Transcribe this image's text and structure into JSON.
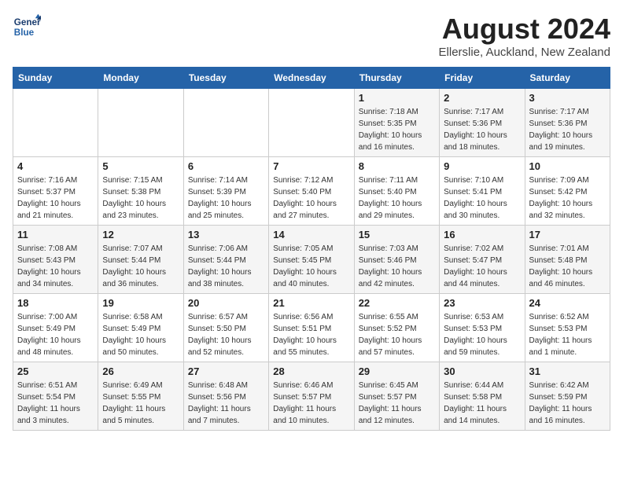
{
  "logo": {
    "line1": "General",
    "line2": "Blue"
  },
  "title": "August 2024",
  "subtitle": "Ellerslie, Auckland, New Zealand",
  "weekdays": [
    "Sunday",
    "Monday",
    "Tuesday",
    "Wednesday",
    "Thursday",
    "Friday",
    "Saturday"
  ],
  "weeks": [
    [
      {
        "day": "",
        "info": ""
      },
      {
        "day": "",
        "info": ""
      },
      {
        "day": "",
        "info": ""
      },
      {
        "day": "",
        "info": ""
      },
      {
        "day": "1",
        "info": "Sunrise: 7:18 AM\nSunset: 5:35 PM\nDaylight: 10 hours\nand 16 minutes."
      },
      {
        "day": "2",
        "info": "Sunrise: 7:17 AM\nSunset: 5:36 PM\nDaylight: 10 hours\nand 18 minutes."
      },
      {
        "day": "3",
        "info": "Sunrise: 7:17 AM\nSunset: 5:36 PM\nDaylight: 10 hours\nand 19 minutes."
      }
    ],
    [
      {
        "day": "4",
        "info": "Sunrise: 7:16 AM\nSunset: 5:37 PM\nDaylight: 10 hours\nand 21 minutes."
      },
      {
        "day": "5",
        "info": "Sunrise: 7:15 AM\nSunset: 5:38 PM\nDaylight: 10 hours\nand 23 minutes."
      },
      {
        "day": "6",
        "info": "Sunrise: 7:14 AM\nSunset: 5:39 PM\nDaylight: 10 hours\nand 25 minutes."
      },
      {
        "day": "7",
        "info": "Sunrise: 7:12 AM\nSunset: 5:40 PM\nDaylight: 10 hours\nand 27 minutes."
      },
      {
        "day": "8",
        "info": "Sunrise: 7:11 AM\nSunset: 5:40 PM\nDaylight: 10 hours\nand 29 minutes."
      },
      {
        "day": "9",
        "info": "Sunrise: 7:10 AM\nSunset: 5:41 PM\nDaylight: 10 hours\nand 30 minutes."
      },
      {
        "day": "10",
        "info": "Sunrise: 7:09 AM\nSunset: 5:42 PM\nDaylight: 10 hours\nand 32 minutes."
      }
    ],
    [
      {
        "day": "11",
        "info": "Sunrise: 7:08 AM\nSunset: 5:43 PM\nDaylight: 10 hours\nand 34 minutes."
      },
      {
        "day": "12",
        "info": "Sunrise: 7:07 AM\nSunset: 5:44 PM\nDaylight: 10 hours\nand 36 minutes."
      },
      {
        "day": "13",
        "info": "Sunrise: 7:06 AM\nSunset: 5:44 PM\nDaylight: 10 hours\nand 38 minutes."
      },
      {
        "day": "14",
        "info": "Sunrise: 7:05 AM\nSunset: 5:45 PM\nDaylight: 10 hours\nand 40 minutes."
      },
      {
        "day": "15",
        "info": "Sunrise: 7:03 AM\nSunset: 5:46 PM\nDaylight: 10 hours\nand 42 minutes."
      },
      {
        "day": "16",
        "info": "Sunrise: 7:02 AM\nSunset: 5:47 PM\nDaylight: 10 hours\nand 44 minutes."
      },
      {
        "day": "17",
        "info": "Sunrise: 7:01 AM\nSunset: 5:48 PM\nDaylight: 10 hours\nand 46 minutes."
      }
    ],
    [
      {
        "day": "18",
        "info": "Sunrise: 7:00 AM\nSunset: 5:49 PM\nDaylight: 10 hours\nand 48 minutes."
      },
      {
        "day": "19",
        "info": "Sunrise: 6:58 AM\nSunset: 5:49 PM\nDaylight: 10 hours\nand 50 minutes."
      },
      {
        "day": "20",
        "info": "Sunrise: 6:57 AM\nSunset: 5:50 PM\nDaylight: 10 hours\nand 52 minutes."
      },
      {
        "day": "21",
        "info": "Sunrise: 6:56 AM\nSunset: 5:51 PM\nDaylight: 10 hours\nand 55 minutes."
      },
      {
        "day": "22",
        "info": "Sunrise: 6:55 AM\nSunset: 5:52 PM\nDaylight: 10 hours\nand 57 minutes."
      },
      {
        "day": "23",
        "info": "Sunrise: 6:53 AM\nSunset: 5:53 PM\nDaylight: 10 hours\nand 59 minutes."
      },
      {
        "day": "24",
        "info": "Sunrise: 6:52 AM\nSunset: 5:53 PM\nDaylight: 11 hours\nand 1 minute."
      }
    ],
    [
      {
        "day": "25",
        "info": "Sunrise: 6:51 AM\nSunset: 5:54 PM\nDaylight: 11 hours\nand 3 minutes."
      },
      {
        "day": "26",
        "info": "Sunrise: 6:49 AM\nSunset: 5:55 PM\nDaylight: 11 hours\nand 5 minutes."
      },
      {
        "day": "27",
        "info": "Sunrise: 6:48 AM\nSunset: 5:56 PM\nDaylight: 11 hours\nand 7 minutes."
      },
      {
        "day": "28",
        "info": "Sunrise: 6:46 AM\nSunset: 5:57 PM\nDaylight: 11 hours\nand 10 minutes."
      },
      {
        "day": "29",
        "info": "Sunrise: 6:45 AM\nSunset: 5:57 PM\nDaylight: 11 hours\nand 12 minutes."
      },
      {
        "day": "30",
        "info": "Sunrise: 6:44 AM\nSunset: 5:58 PM\nDaylight: 11 hours\nand 14 minutes."
      },
      {
        "day": "31",
        "info": "Sunrise: 6:42 AM\nSunset: 5:59 PM\nDaylight: 11 hours\nand 16 minutes."
      }
    ]
  ]
}
